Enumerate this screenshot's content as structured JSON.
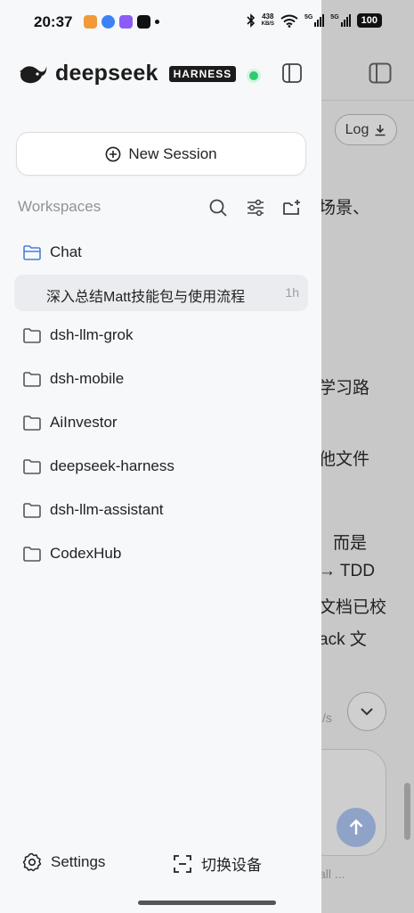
{
  "status_bar": {
    "time": "20:37",
    "net_speed_value": "438",
    "net_speed_unit": "KB/S",
    "battery": "100",
    "signal_1": "5G",
    "signal_2": "5G"
  },
  "drawer": {
    "brand": "deepseek",
    "badge": "HARNESS",
    "new_session_label": "New Session",
    "workspaces_label": "Workspaces",
    "folders": [
      {
        "name": "Chat",
        "active": true
      },
      {
        "name": "dsh-llm-grok"
      },
      {
        "name": "dsh-mobile"
      },
      {
        "name": "AiInvestor"
      },
      {
        "name": "deepseek-harness"
      },
      {
        "name": "dsh-llm-assistant"
      },
      {
        "name": "CodexHub"
      }
    ],
    "session": {
      "title": "深入总结Matt技能包与使用流程",
      "time": "1h"
    },
    "footer": {
      "settings_label": "Settings",
      "switch_device_label": "切换设备"
    }
  },
  "background": {
    "log_button_label": "Log",
    "text_lines": [
      "场景、",
      "学习路",
      "他文件",
      "而是",
      "→ TDD",
      "文档已校",
      "ack 文"
    ],
    "faded_small": "/s",
    "input_hint": "all ..."
  },
  "colors": {
    "accent": "#4a7fd6",
    "online": "#2ecc71",
    "send_button": "#8fa3c9"
  }
}
